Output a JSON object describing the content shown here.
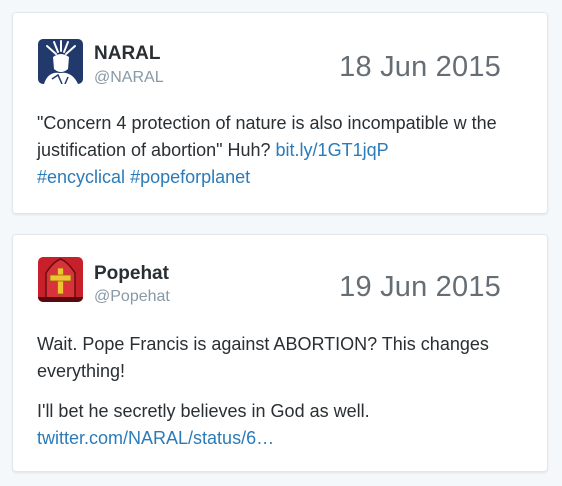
{
  "tweets": [
    {
      "name": "NARAL",
      "handle": "@NARAL",
      "date": "18 Jun 2015",
      "avatar_icon": "statue-of-liberty-icon",
      "text_main": "\"Concern 4 protection of nature is also incompatible w the justification of abortion\" Huh?",
      "link": "bit.ly/1GT1jqP",
      "hashtag_1": "#encyclical",
      "hashtag_2": "#popeforplanet"
    },
    {
      "name": "Popehat",
      "handle": "@Popehat",
      "date": "19 Jun 2015",
      "avatar_icon": "pope-hat-icon",
      "text_a": "Wait. Pope Francis is against ABORTION? This changes everything!",
      "text_b": "I'll bet he secretly believes in God as well.",
      "link": "twitter.com/NARAL/status/6…"
    }
  ],
  "colors": {
    "link": "#2b7bb9",
    "date": "#666e75",
    "handle": "#8899a6",
    "naral_avatar_bg": "#223a6b",
    "popehat_avatar_bg": "#c8202a"
  }
}
